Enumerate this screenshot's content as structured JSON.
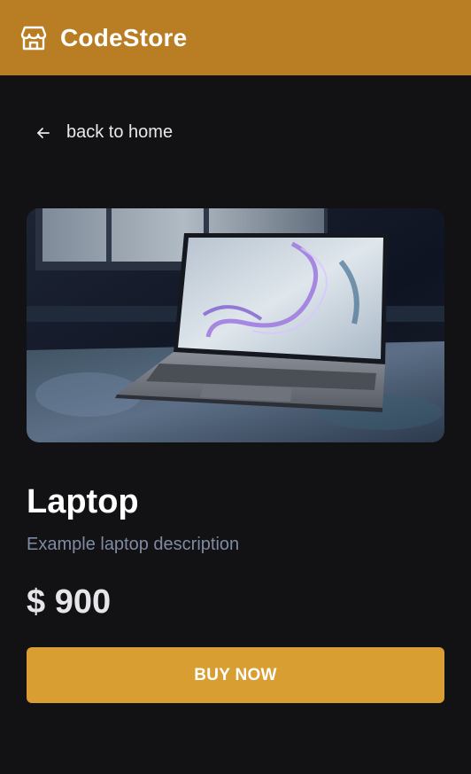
{
  "header": {
    "brand": "CodeStore",
    "logo_icon": "storefront-icon",
    "background": "#b97d23"
  },
  "nav": {
    "back_label": "back to home",
    "back_icon": "arrow-left-icon"
  },
  "product": {
    "image_alt": "laptop-photo",
    "title": "Laptop",
    "description": "Example laptop description",
    "price": "$ 900"
  },
  "actions": {
    "buy_label": "BUY NOW",
    "buy_color": "#d89e32"
  },
  "theme": {
    "page_background": "#121214",
    "description_color": "#7f8aa3"
  }
}
